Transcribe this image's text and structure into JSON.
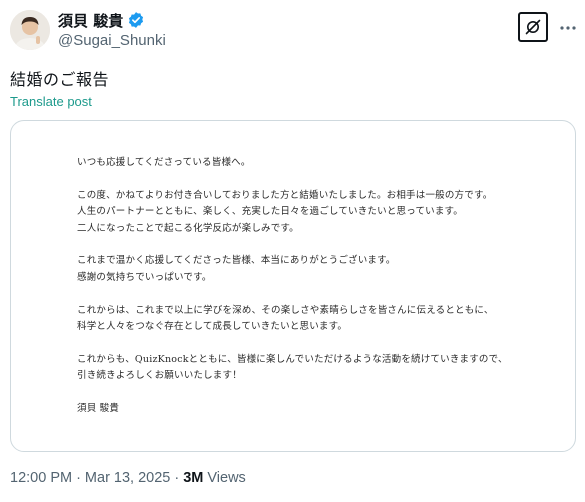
{
  "author": {
    "display_name": "須貝 駿貴",
    "handle": "@Sugai_Shunki"
  },
  "tweet": {
    "text": "結婚のご報告",
    "translate_label": "Translate post"
  },
  "document": {
    "lines": [
      "いつも応援してくださっている皆様へ。",
      "",
      "この度、かねてよりお付き合いしておりました方と結婚いたしました。お相手は一般の方です。",
      "人生のパートナーとともに、楽しく、充実した日々を過ごしていきたいと思っています。",
      "二人になったことで起こる化学反応が楽しみです。",
      "",
      "これまで温かく応援してくださった皆様、本当にありがとうございます。",
      "感謝の気持ちでいっぱいです。",
      "",
      "これからは、これまで以上に学びを深め、その楽しさや素晴らしさを皆さんに伝えるとともに、",
      "科学と人々をつなぐ存在として成長していきたいと思います。",
      "",
      "これからも、QuizKnockとともに、皆様に楽しんでいただけるような活動を続けていきますので、",
      "引き続きよろしくお願いいたします！",
      "",
      "須貝 駿貴"
    ]
  },
  "meta": {
    "time": "12:00 PM",
    "separator": "·",
    "date": "Mar 13, 2025",
    "views_count": "3M",
    "views_label": "Views"
  },
  "colors": {
    "verified": "#1d9bf0",
    "link": "#1d9a8c",
    "secondary_text": "#536471"
  }
}
